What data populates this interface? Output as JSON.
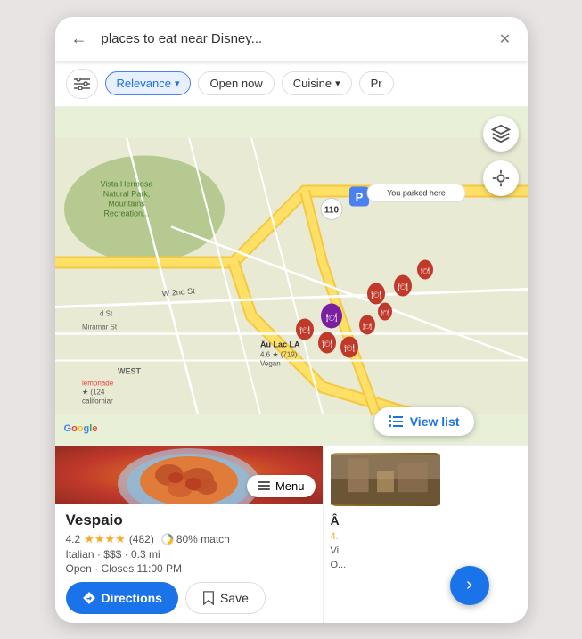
{
  "search": {
    "query": "places to eat near Disney...",
    "placeholder": "places to eat near Disney..."
  },
  "filters": {
    "icon_label": "⊞",
    "chips": [
      {
        "id": "relevance",
        "label": "Relevance",
        "active": true,
        "has_arrow": true
      },
      {
        "id": "open_now",
        "label": "Open now",
        "active": false,
        "has_arrow": false
      },
      {
        "id": "cuisine",
        "label": "Cuisine",
        "active": false,
        "has_arrow": true
      },
      {
        "id": "price",
        "label": "Pr",
        "active": false,
        "has_arrow": false
      }
    ]
  },
  "map": {
    "layer_icon": "◈",
    "location_icon": "◎",
    "view_list_label": "View list",
    "google_logo": [
      "G",
      "o",
      "o",
      "g",
      "l",
      "e"
    ],
    "parked_here_label": "You parked here"
  },
  "featured_restaurant": {
    "name": "Vespaio",
    "rating": "4.2",
    "review_count": "(482)",
    "match_percent": "80% match",
    "cuisine": "Italian",
    "price": "$$$",
    "distance": "0.3 mi",
    "status": "Open",
    "closes": "Closes 11:00 PM",
    "menu_label": "Menu",
    "directions_label": "Directions",
    "save_label": "Save"
  },
  "side_card": {
    "name": "Â",
    "rating": "4.",
    "info": "Vi",
    "extra": "O..."
  },
  "map_labels": {
    "vista_hermosa": "Vista Hermosa Natural Park, Mountains Recreation...",
    "street_2nd": "W 2nd St",
    "au_lac": "Âu Lạc LA",
    "au_lac_rating": "4.6 ★ (719)",
    "au_lac_type": "Vegan",
    "west_label": "WEST",
    "highway_110": "110",
    "lemonade": "lemonade",
    "lemonade_rating": "★ (124",
    "californiar": "californiar"
  }
}
